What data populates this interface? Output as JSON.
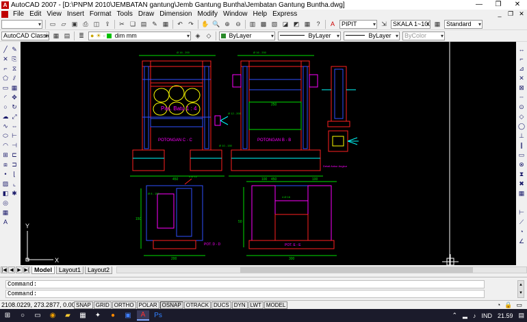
{
  "window": {
    "title": "AutoCAD 2007 - [D:\\PNPM 2010\\JEMBATAN gantung\\Jemb Gantung Buntha\\Jembatan Gantung Buntha.dwg]",
    "app_icon": "A",
    "minimize": "—",
    "maximize": "❐",
    "close": "✕"
  },
  "menu": {
    "items": [
      "File",
      "Edit",
      "View",
      "Insert",
      "Format",
      "Tools",
      "Draw",
      "Dimension",
      "Modify",
      "Window",
      "Help",
      "Express"
    ]
  },
  "toolbar1": {
    "dimstyle": "PIPIT",
    "scale": "SKALA 1~100",
    "textstyle": "Standard"
  },
  "toolbar2": {
    "workspace": "AutoCAD Classic",
    "layer": "dim mm",
    "color": "ByLayer",
    "linetype": "ByLayer",
    "lineweight": "ByLayer",
    "plotstyle": "ByColor"
  },
  "drawing": {
    "section_cc": "POTONGAN C - C",
    "section_bb": "POTONGAN B - B",
    "pot_dd": "POT. D - D",
    "pot_ee": "POT. E - E",
    "stone_label": "Pas. Batu 1 : 4",
    "detail_label": "Detail Ankur Angkur",
    "dims": {
      "d250": "250",
      "d450": "450",
      "d200": "200",
      "d100": "100",
      "d150": "150",
      "d50": "50",
      "d300": "300",
      "d400": "400"
    },
    "rebar": {
      "r1": "Ø 16 - 200",
      "r2": "Ø 12 - 200",
      "r3": "Ø 10 - 150",
      "r4": "4 Ø 12",
      "r5": "4 Ø 16",
      "r6": "Ø 8 - 150"
    },
    "ucs_x": "X",
    "ucs_y": "Y"
  },
  "tabs": [
    "Model",
    "Layout1",
    "Layout2"
  ],
  "command": {
    "line1": "Command:",
    "line2": "Command:"
  },
  "status": {
    "coords": "2108.0229, 273.2877, 0.0000",
    "buttons": [
      "SNAP",
      "GRID",
      "ORTHO",
      "POLAR",
      "OSNAP",
      "OTRACK",
      "DUCS",
      "DYN",
      "LWT",
      "MODEL"
    ]
  },
  "taskbar": {
    "lang": "IND",
    "time": "21.59"
  },
  "colors": {
    "canvas": "#000000",
    "red": "#ff2020",
    "blue": "#3050ff",
    "magenta": "#ff00ff",
    "green": "#00e000",
    "cyan": "#00ffff",
    "yellow": "#ffff00"
  }
}
